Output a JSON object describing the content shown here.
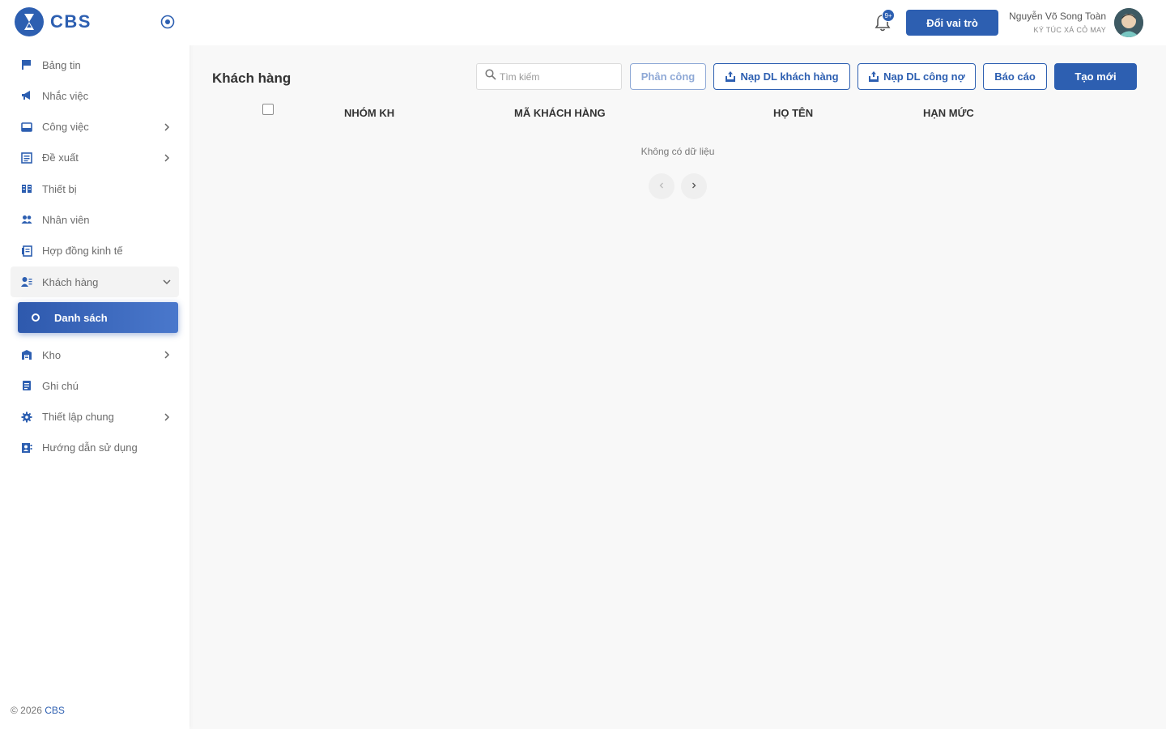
{
  "brand": {
    "name": "CBS"
  },
  "sidebar": {
    "items": [
      {
        "label": "Bảng tin",
        "icon": "flag-icon"
      },
      {
        "label": "Nhắc việc",
        "icon": "megaphone-icon"
      },
      {
        "label": "Công việc",
        "icon": "tray-icon",
        "has_children": true
      },
      {
        "label": "Đề xuất",
        "icon": "list-document-icon",
        "has_children": true
      },
      {
        "label": "Thiết bị",
        "icon": "grid-book-icon"
      },
      {
        "label": "Nhân viên",
        "icon": "people-icon"
      },
      {
        "label": "Hợp đồng kinh tế",
        "icon": "contract-icon"
      },
      {
        "label": "Khách hàng",
        "icon": "customer-icon",
        "expanded": true
      },
      {
        "label": "Kho",
        "icon": "warehouse-icon",
        "has_children": true
      },
      {
        "label": "Ghi chú",
        "icon": "note-icon"
      },
      {
        "label": "Thiết lập chung",
        "icon": "gear-icon",
        "has_children": true
      },
      {
        "label": "Hướng dẫn sử dụng",
        "icon": "contact-book-icon"
      }
    ],
    "active_sub": {
      "label": "Danh sách"
    }
  },
  "footer": {
    "prefix": "© 2026",
    "brand": "CBS"
  },
  "header": {
    "notification_badge": "9+",
    "role_button": "Đổi vai trò",
    "user_name": "Nguyễn Võ Song Toàn",
    "user_org": "KÝ TÚC XÁ CỎ MAY"
  },
  "page": {
    "title": "Khách hàng",
    "search_placeholder": "Tìm kiếm",
    "buttons": {
      "assign": "Phân công",
      "import_customers": "Nạp DL khách hàng",
      "import_debts": "Nạp DL công nợ",
      "report": "Báo cáo",
      "create": "Tạo mới"
    },
    "table": {
      "columns": [
        "NHÓM KH",
        "MÃ KHÁCH HÀNG",
        "HỌ TÊN",
        "HẠN MỨC"
      ],
      "empty_text": "Không có dữ liệu"
    }
  },
  "colors": {
    "primary": "#2d5fb1",
    "disabled": "#8fa9d6"
  }
}
